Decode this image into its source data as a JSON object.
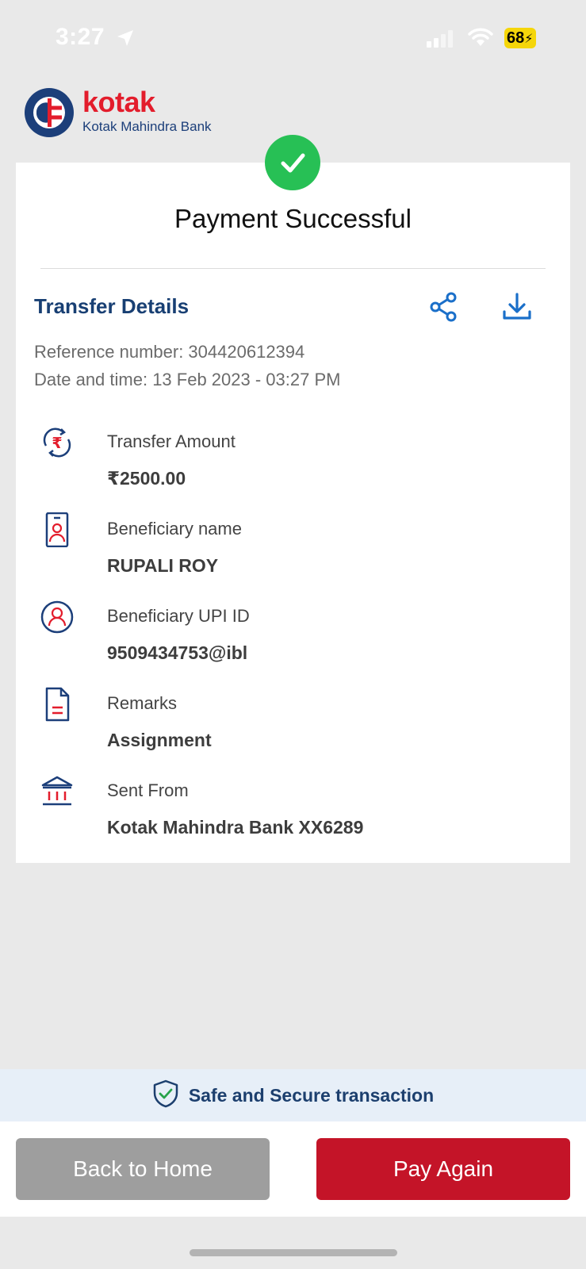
{
  "status_bar": {
    "time": "3:27",
    "battery": "68"
  },
  "brand": {
    "name": "kotak",
    "full_name": "Kotak Mahindra Bank",
    "color": "#e31d2c",
    "navy": "#1c3f7a"
  },
  "receipt": {
    "title": "Payment Successful",
    "section_title": "Transfer Details",
    "reference": "Reference number: 304420612394",
    "datetime": "Date and time: 13 Feb 2023 - 03:27 PM",
    "details": [
      {
        "icon": "rupee-transfer-icon",
        "label": "Transfer Amount",
        "value": "₹2500.00"
      },
      {
        "icon": "id-card-icon",
        "label": "Beneficiary name",
        "value": "RUPALI ROY"
      },
      {
        "icon": "user-circle-icon",
        "label": "Beneficiary UPI ID",
        "value": "9509434753@ibl"
      },
      {
        "icon": "document-icon",
        "label": "Remarks",
        "value": "Assignment"
      },
      {
        "icon": "bank-icon",
        "label": "Sent From",
        "value": "Kotak Mahindra Bank XX6289"
      }
    ]
  },
  "footer": {
    "secure_text": "Safe and Secure transaction",
    "back_label": "Back to Home",
    "pay_again_label": "Pay Again"
  },
  "colors": {
    "success": "#27c055",
    "primary_red": "#c41428",
    "accent_blue": "#1a6fc9"
  }
}
